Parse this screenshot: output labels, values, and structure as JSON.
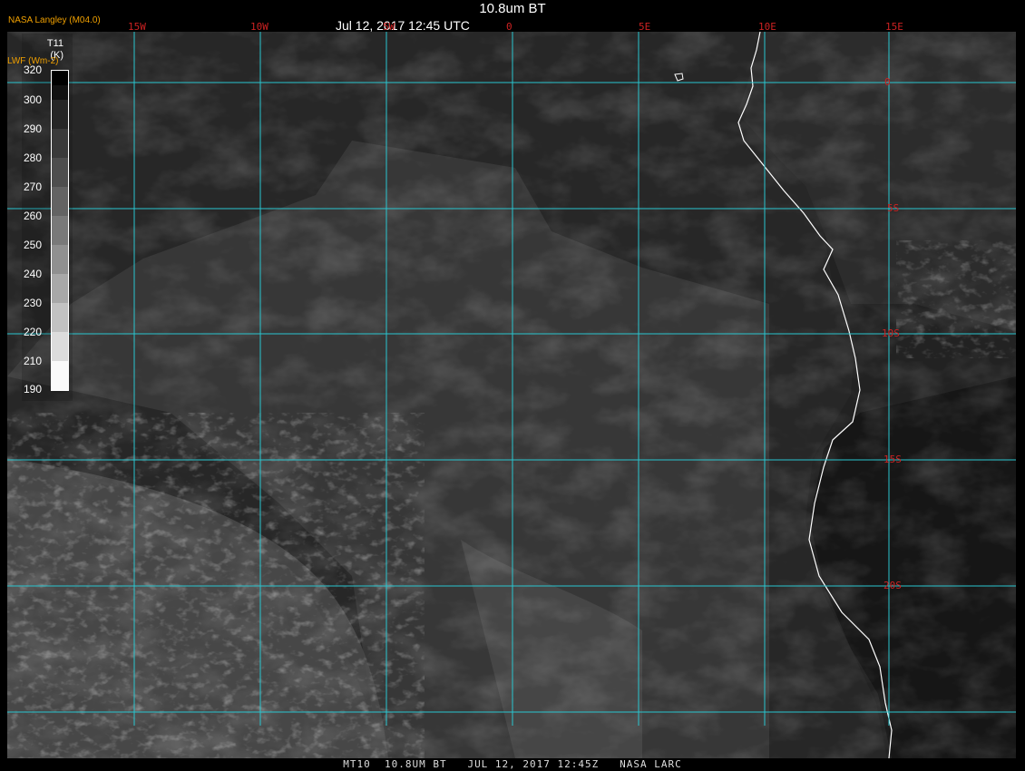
{
  "header": {
    "title": "10.8um BT",
    "datetime": "Jul 12, 2017 12:45 UTC",
    "credit": "NASA Langley (M04.0)"
  },
  "footer": {
    "caption": "MT10  10.8UM BT   JUL 12, 2017 12:45Z   NASA LARC"
  },
  "legend": {
    "variable": "T11",
    "unit": "(K)",
    "alt_label": "LWF (Wm-2)",
    "values": [
      "320",
      "300",
      "290",
      "280",
      "270",
      "260",
      "250",
      "240",
      "230",
      "220",
      "210",
      "190"
    ]
  },
  "grid": {
    "lon_labels": [
      "15W",
      "10W",
      "5W",
      "0",
      "5E",
      "10E",
      "15E"
    ],
    "lat_labels": [
      "0",
      "5S",
      "10S",
      "15S",
      "20S"
    ]
  },
  "colors": {
    "gridline": "#29c6d0",
    "coastline": "#ffffff",
    "grid_label": "#cc2222",
    "credit": "#f0a000"
  }
}
